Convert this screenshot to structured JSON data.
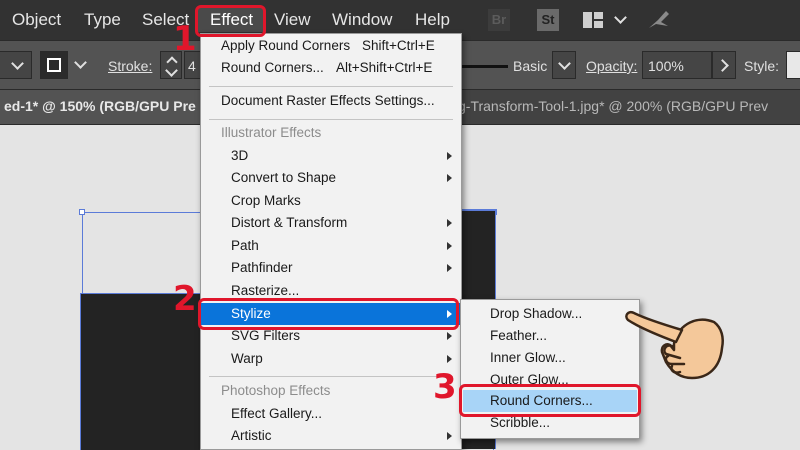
{
  "menubar": {
    "items": [
      "Object",
      "Type",
      "Select",
      "Effect",
      "View",
      "Window",
      "Help"
    ],
    "app_icons": [
      "Br",
      "St"
    ]
  },
  "controlbar": {
    "stroke_label": "Stroke:",
    "stroke_value": "4",
    "brush_name": "Basic",
    "opacity_label": "Opacity:",
    "opacity_value": "100%",
    "style_label": "Style:"
  },
  "tabs": {
    "tab1": "ed-1* @ 150% (RGB/GPU Pre",
    "tab2": "g-Transform-Tool-1.jpg* @ 200% (RGB/GPU Prev"
  },
  "effect_menu": {
    "apply_round_corners": {
      "label": "Apply Round Corners",
      "shortcut": "Shift+Ctrl+E"
    },
    "round_corners_dialog": {
      "label": "Round Corners...",
      "shortcut": "Alt+Shift+Ctrl+E"
    },
    "document_raster_settings": "Document Raster Effects Settings...",
    "illustrator_effects_header": "Illustrator Effects",
    "illustrator_items": [
      "3D",
      "Convert to Shape",
      "Crop Marks",
      "Distort & Transform",
      "Path",
      "Pathfinder",
      "Rasterize...",
      "Stylize",
      "SVG Filters",
      "Warp"
    ],
    "photoshop_effects_header": "Photoshop Effects",
    "photoshop_items": [
      "Effect Gallery...",
      "Artistic"
    ]
  },
  "stylize_submenu": {
    "items": [
      "Drop Shadow...",
      "Feather...",
      "Inner Glow...",
      "Outer Glow...",
      "Round Corners...",
      "Scribble..."
    ]
  },
  "annotations": {
    "steps": [
      "1",
      "2",
      "3"
    ],
    "color": "#e0162b"
  },
  "colors": {
    "selection_blue": "#0a74da",
    "hover_blue": "#a8d4f7"
  }
}
